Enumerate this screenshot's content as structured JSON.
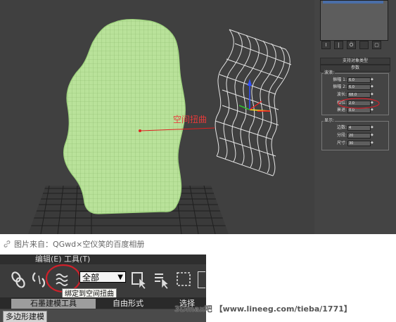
{
  "viewport": {
    "annotation": "空间扭曲"
  },
  "command_panel": {
    "rollouts": [
      "支持对象类型",
      "参数"
    ],
    "group_waves": "波浪:",
    "params_waves": [
      {
        "label": "振幅 1:",
        "value": "6.0"
      },
      {
        "label": "振幅 2:",
        "value": "6.0"
      },
      {
        "label": "波长:",
        "value": "68.0"
      },
      {
        "label": "相位:",
        "value": "2.0"
      },
      {
        "label": "衰退:",
        "value": "0.0"
      }
    ],
    "group_display": "显示:",
    "params_display": [
      {
        "label": "边数:",
        "value": "4"
      },
      {
        "label": "分段:",
        "value": "20"
      },
      {
        "label": "尺寸:",
        "value": "30"
      }
    ],
    "tool_buttons": [
      "I",
      "|",
      "Ö",
      "▢"
    ]
  },
  "caption": {
    "icon": "link-icon",
    "text": "图片来自：QGwd×空仪笑的百度相册"
  },
  "toolbar": {
    "menu_partial": "编辑(E)     工具(T)",
    "select_filter": "全部",
    "tooltip": "绑定到空间扭曲",
    "tabs": [
      "石墨建模工具",
      "自由形式",
      "选择"
    ],
    "subtab": "多边形建模",
    "highlight_color": "#d0202a"
  },
  "watermark": "3Dmax吧 【www.lineeg.com/tieba/1771】"
}
